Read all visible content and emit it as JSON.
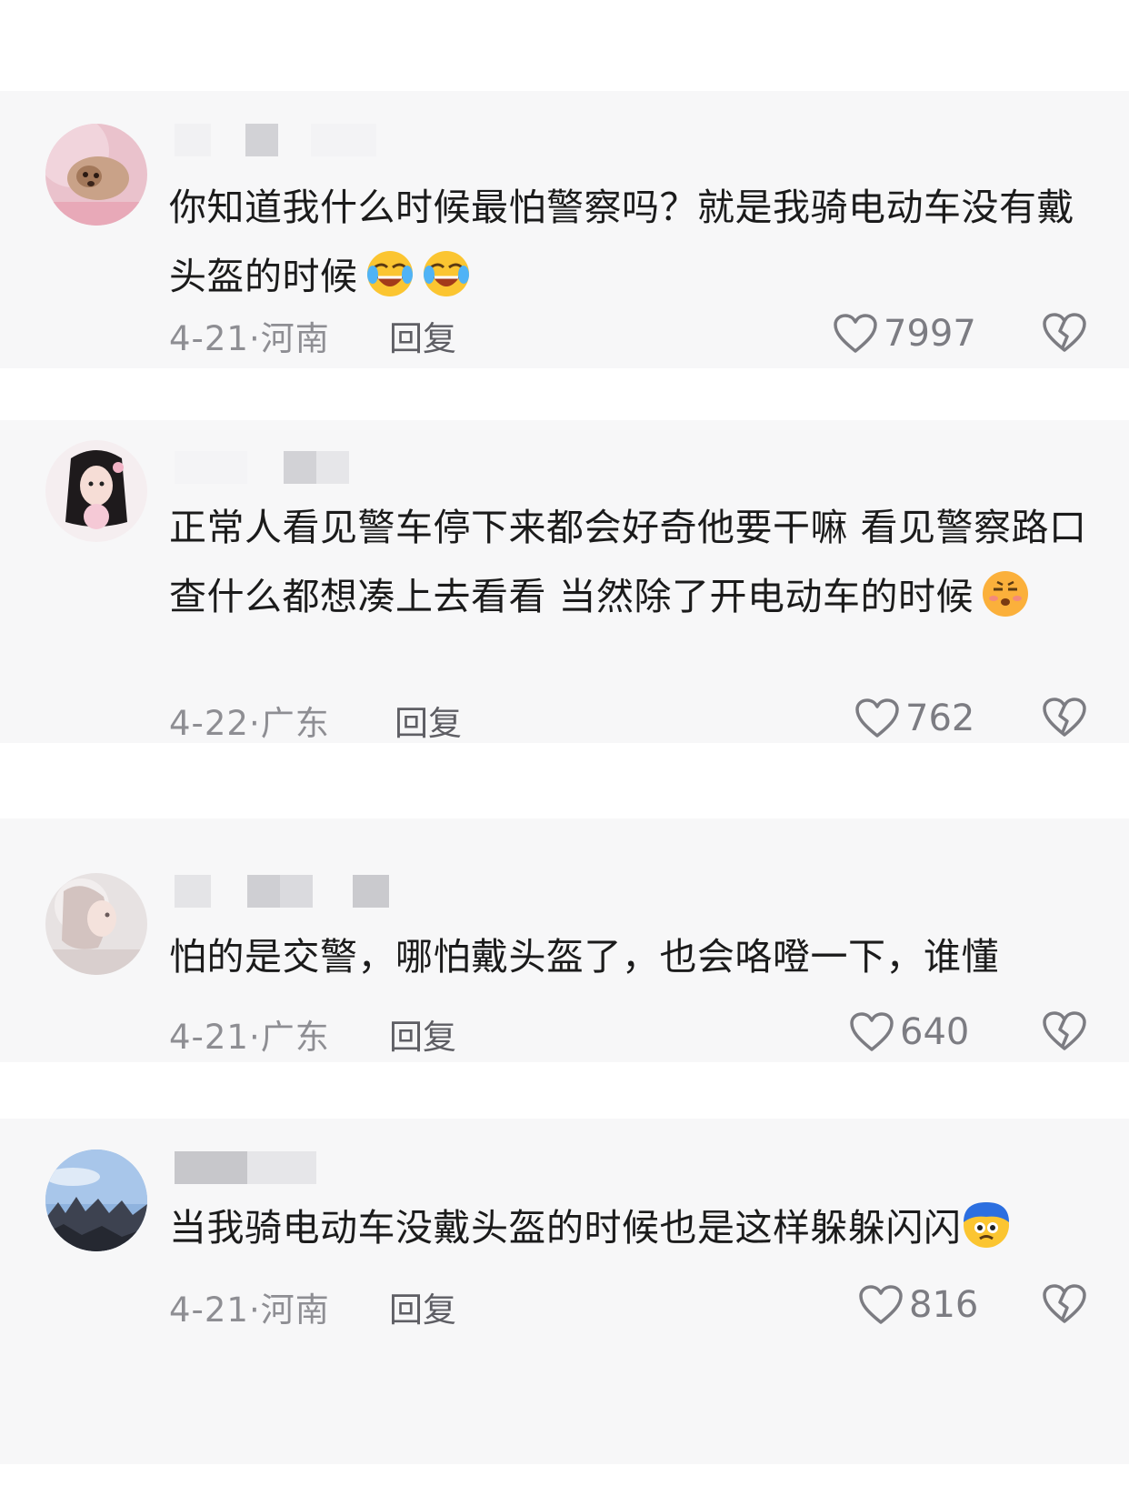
{
  "comments": [
    {
      "text": "你知道我什么时候最怕警察吗？就是我骑电动车没有戴头盔的时候",
      "emojis": [
        "laugh-cry",
        "laugh-cry"
      ],
      "date": "4-21·河南",
      "reply": "回复",
      "likes": "7997"
    },
    {
      "text": "正常人看见警车停下来都会好奇他要干嘛 看见警察路口查什么都想凑上去看看 当然除了开电动车的时候",
      "emojis": [
        "smirk"
      ],
      "date": "4-22·广东",
      "reply": "回复",
      "likes": "762"
    },
    {
      "text": "怕的是交警，哪怕戴头盔了，也会咯噔一下，谁懂",
      "emojis": [],
      "date": "4-21·广东",
      "reply": "回复",
      "likes": "640"
    },
    {
      "text": "当我骑电动车没戴头盔的时候也是这样躲躲闪闪",
      "emojis": [
        "scared-blue"
      ],
      "date": "4-21·河南",
      "reply": "回复",
      "likes": "816"
    }
  ],
  "icons": {
    "like": "heart-outline-icon",
    "dislike": "broken-heart-icon"
  },
  "colors": {
    "text": "#1b1b1b",
    "meta": "#8e8e93",
    "card": "#f7f7f8"
  }
}
